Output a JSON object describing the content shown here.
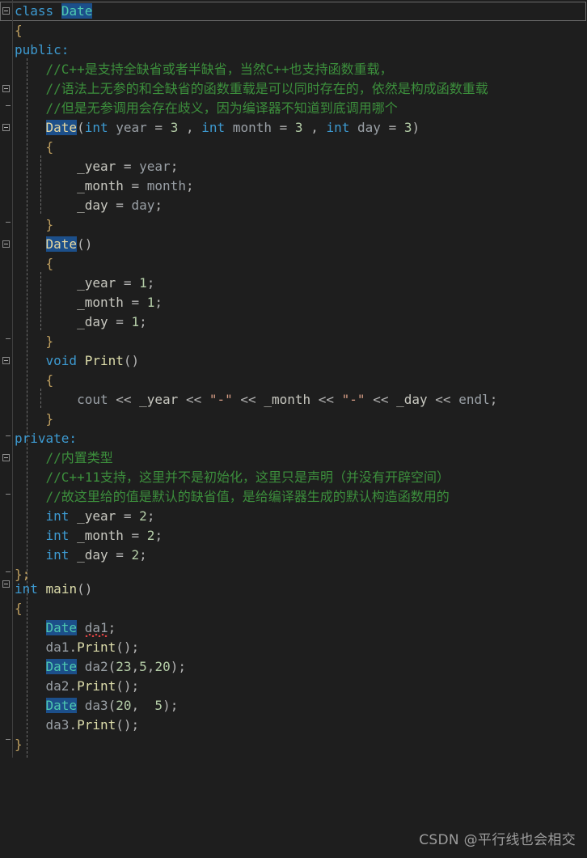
{
  "editor": {
    "background": "#1e1e1e",
    "language": "C++",
    "line_height": 24,
    "font_size": 16
  },
  "colors": {
    "keyword": "#3d9ad1",
    "comment": "#3c8f3c",
    "type_highlight_bg": "#1c4f8a",
    "type_decl_fg": "#e8d9a0",
    "type_use_fg": "#4ec9b0",
    "number": "#b5cea8",
    "function": "#dcdcaa",
    "string": "#d69d85",
    "identifier": "#9aa0a6",
    "error_squiggle": "#dd4444"
  },
  "watermark": {
    "text": "CSDN @平行线也会相交"
  },
  "lines": [
    {
      "n": 1,
      "text": "class Date"
    },
    {
      "n": 2,
      "text": "{"
    },
    {
      "n": 3,
      "text": "public:"
    },
    {
      "n": 4,
      "text": "    //C++是支持全缺省或者半缺省，当然C++也支持函数重载，"
    },
    {
      "n": 5,
      "text": "    //语法上无参的和全缺省的函数重载是可以同时存在的，依然是构成函数重载"
    },
    {
      "n": 6,
      "text": "    //但是无参调用会存在歧义，因为编译器不知道到底调用哪个"
    },
    {
      "n": 7,
      "text": "    Date(int year = 3 , int month = 3 , int day = 3)"
    },
    {
      "n": 8,
      "text": "    {"
    },
    {
      "n": 9,
      "text": "        _year = year;"
    },
    {
      "n": 10,
      "text": "        _month = month;"
    },
    {
      "n": 11,
      "text": "        _day = day;"
    },
    {
      "n": 12,
      "text": "    }"
    },
    {
      "n": 13,
      "text": "    Date()"
    },
    {
      "n": 14,
      "text": "    {"
    },
    {
      "n": 15,
      "text": "        _year = 1;"
    },
    {
      "n": 16,
      "text": "        _month = 1;"
    },
    {
      "n": 17,
      "text": "        _day = 1;"
    },
    {
      "n": 18,
      "text": "    }"
    },
    {
      "n": 19,
      "text": "    void Print()"
    },
    {
      "n": 20,
      "text": "    {"
    },
    {
      "n": 21,
      "text": "        cout << _year << \"-\" << _month << \"-\" << _day << endl;"
    },
    {
      "n": 22,
      "text": "    }"
    },
    {
      "n": 23,
      "text": "private:"
    },
    {
      "n": 24,
      "text": "    //内置类型"
    },
    {
      "n": 25,
      "text": "    //C++11支持，这里并不是初始化，这里只是声明（并没有开辟空间）"
    },
    {
      "n": 26,
      "text": "    //故这里给的值是默认的缺省值，是给编译器生成的默认构造函数用的"
    },
    {
      "n": 27,
      "text": "    int _year = 2;"
    },
    {
      "n": 28,
      "text": "    int _month = 2;"
    },
    {
      "n": 29,
      "text": "    int _day = 2;"
    },
    {
      "n": 30,
      "text": "};"
    },
    {
      "n": 31,
      "text": "int main()"
    },
    {
      "n": 32,
      "text": "{"
    },
    {
      "n": 33,
      "text": "    Date da1;"
    },
    {
      "n": 34,
      "text": "    da1.Print();"
    },
    {
      "n": 35,
      "text": "    Date da2(23,5,20);"
    },
    {
      "n": 36,
      "text": "    da2.Print();"
    },
    {
      "n": 37,
      "text": "    Date da3(20,  5);"
    },
    {
      "n": 38,
      "text": "    da3.Print();"
    },
    {
      "n": 39,
      "text": "}"
    }
  ],
  "tokens": {
    "kw_class": "class",
    "kw_public": "public:",
    "kw_private": "private:",
    "kw_int": "int",
    "kw_void": "void",
    "type_date": "Date",
    "brace_open": "{",
    "brace_close": "}",
    "brace_close_semi": "};",
    "comment_1": "//C++是支持全缺省或者半缺省，当然C++也支持函数重载，",
    "comment_2": "//语法上无参的和全缺省的函数重载是可以同时存在的，依然是构成函数重载",
    "comment_3": "//但是无参调用会存在歧义，因为编译器不知道到底调用哪个",
    "comment_4": "//内置类型",
    "comment_5": "//C++11支持，这里并不是初始化，这里只是声明（并没有开辟空间）",
    "comment_6": "//故这里给的值是默认的缺省值，是给编译器生成的默认构造函数用的",
    "fn_print": "Print",
    "fn_main": "main",
    "id_cout": "cout",
    "id_endl": "endl",
    "m_year": "_year",
    "m_month": "_month",
    "m_day": "_day",
    "p_year": "year",
    "p_month": "month",
    "p_day": "day",
    "var_da1": "da1",
    "var_da2": "da2",
    "var_da3": "da3",
    "str_dash": "\"-\"",
    "op_shift": "<<",
    "op_assign": "=",
    "n_1": "1",
    "n_2": "2",
    "n_3": "3",
    "n_5": "5",
    "n_20": "20",
    "n_23": "23"
  }
}
